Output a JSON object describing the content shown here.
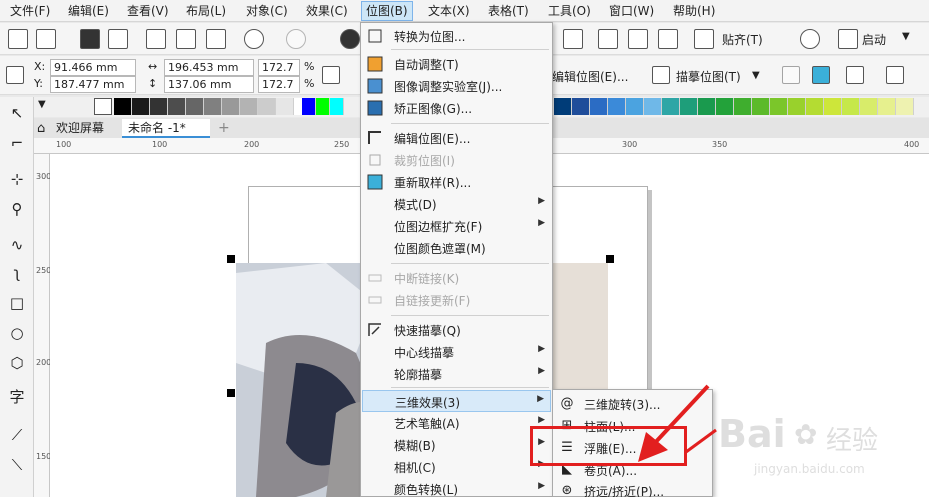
{
  "menubar": {
    "items": [
      {
        "label": "文件(F)"
      },
      {
        "label": "编辑(E)"
      },
      {
        "label": "查看(V)"
      },
      {
        "label": "布局(L)"
      },
      {
        "label": "对象(C)"
      },
      {
        "label": "效果(C)"
      },
      {
        "label": "位图(B)"
      },
      {
        "label": "文本(X)"
      },
      {
        "label": "表格(T)"
      },
      {
        "label": "工具(O)"
      },
      {
        "label": "窗口(W)"
      },
      {
        "label": "帮助(H)"
      }
    ]
  },
  "toolbar": {
    "snap_label": "贴齐(T)",
    "launch_label": "启动",
    "edit_bitmap_label": "编辑位图(E)...",
    "trace_bitmap_label": "描摹位图(T)"
  },
  "property_bar": {
    "x_label": "X:",
    "x_value": "91.466 mm",
    "y_label": "Y:",
    "y_value": "187.477 mm",
    "width_value": "196.453 mm",
    "height_value": "137.06 mm",
    "scale_x": "172.7",
    "scale_y": "172.7",
    "percent": "%"
  },
  "tabs": [
    {
      "label": "欢迎屏幕"
    },
    {
      "label": "未命名 -1*"
    }
  ],
  "ruler": {
    "h_ticks": [
      "100",
      "100",
      "200",
      "250",
      "300",
      "350",
      "400"
    ],
    "v_ticks": [
      "300",
      "250",
      "200",
      "150"
    ]
  },
  "bitmap_menu": {
    "items": [
      {
        "label": "转换为位图..."
      },
      {
        "label": "自动调整(T)"
      },
      {
        "label": "图像调整实验室(J)..."
      },
      {
        "label": "矫正图像(G)..."
      },
      {
        "label": "编辑位图(E)..."
      },
      {
        "label": "裁剪位图(I)"
      },
      {
        "label": "重新取样(R)..."
      },
      {
        "label": "模式(D)"
      },
      {
        "label": "位图边框扩充(F)"
      },
      {
        "label": "位图颜色遮罩(M)"
      },
      {
        "label": "中断链接(K)"
      },
      {
        "label": "自链接更新(F)"
      },
      {
        "label": "快速描摹(Q)"
      },
      {
        "label": "中心线描摹"
      },
      {
        "label": "轮廓描摹"
      },
      {
        "label": "三维效果(3)"
      },
      {
        "label": "艺术笔触(A)"
      },
      {
        "label": "模糊(B)"
      },
      {
        "label": "相机(C)"
      },
      {
        "label": "颜色转换(L)"
      }
    ]
  },
  "submenu_3d": {
    "items": [
      {
        "label": "三维旋转(3)..."
      },
      {
        "label": "柱面(L)..."
      },
      {
        "label": "浮雕(E)..."
      },
      {
        "label": "卷页(A)..."
      },
      {
        "label": "挤远/挤近(P)..."
      }
    ]
  },
  "watermark": {
    "brand": "Bai",
    "brand2": "经验",
    "url": "jingyan.baidu.com"
  },
  "colors": {
    "accent_red": "#e21f1f",
    "menu_highlight": "#d8eaf9"
  }
}
